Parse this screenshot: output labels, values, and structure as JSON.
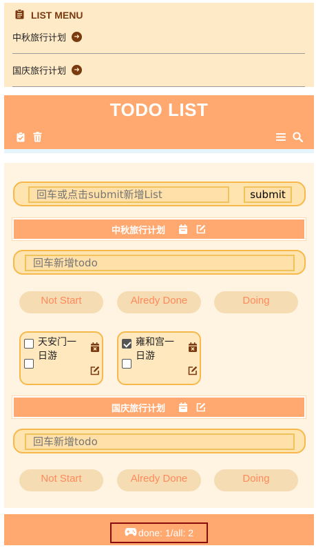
{
  "list_menu": {
    "title": "LIST MENU",
    "items": [
      {
        "label": "中秋旅行计划"
      },
      {
        "label": "国庆旅行计划"
      }
    ]
  },
  "header": {
    "title": "TODO LIST"
  },
  "new_list": {
    "placeholder": "回车或点击submit新增List",
    "submit_label": "submit"
  },
  "filters": {
    "not_start": "Not Start",
    "done": "Alredy Done",
    "doing": "Doing"
  },
  "lists": [
    {
      "name": "中秋旅行计划",
      "input_placeholder": "回车新增todo",
      "todos": [
        {
          "check1": false,
          "check2": false,
          "text": "天安门一日游"
        },
        {
          "check1": true,
          "check2": false,
          "text": "雍和宫一日游"
        }
      ]
    },
    {
      "name": "国庆旅行计划",
      "input_placeholder": "回车新增todo",
      "todos": []
    }
  ],
  "footer": {
    "stats": "done: 1/all: 2"
  },
  "colors": {
    "menu_bg": "#ffeac8",
    "accent": "#ffa86f",
    "main_bg": "#fff4e2",
    "border": "#f7b84a",
    "filter_text": "#ff8a5c",
    "icon_dark": "#7a3a10",
    "stats_border": "#8a0b0b"
  }
}
